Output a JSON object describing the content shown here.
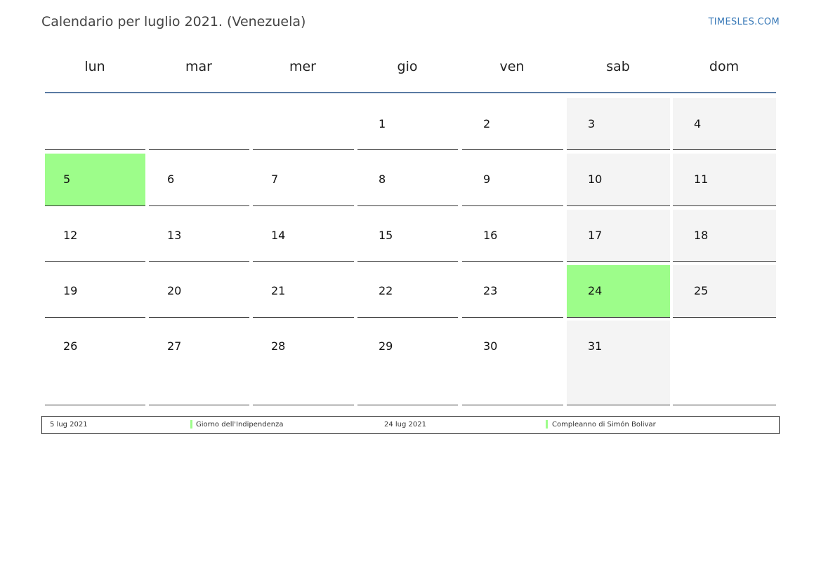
{
  "header": {
    "title": "Calendario per luglio 2021. (Venezuela)",
    "brand": "TIMESLES.COM"
  },
  "weekdays": [
    "lun",
    "mar",
    "mer",
    "gio",
    "ven",
    "sab",
    "dom"
  ],
  "weeks": [
    [
      "",
      "",
      "",
      "1",
      "2",
      "3",
      "4"
    ],
    [
      "5",
      "6",
      "7",
      "8",
      "9",
      "10",
      "11"
    ],
    [
      "12",
      "13",
      "14",
      "15",
      "16",
      "17",
      "18"
    ],
    [
      "19",
      "20",
      "21",
      "22",
      "23",
      "24",
      "25"
    ],
    [
      "26",
      "27",
      "28",
      "29",
      "30",
      "31",
      ""
    ]
  ],
  "holidays": [
    {
      "date": "5 lug 2021",
      "name": "Giorno dell'Indipendenza",
      "day": "5"
    },
    {
      "date": "24 lug 2021",
      "name": "Compleanno di Simón Bolivar",
      "day": "24"
    }
  ],
  "colors": {
    "holiday": "#9dfd8a",
    "weekend": "#f4f4f4",
    "header_rule": "#5a7ba3",
    "brand": "#3a7ab8"
  }
}
